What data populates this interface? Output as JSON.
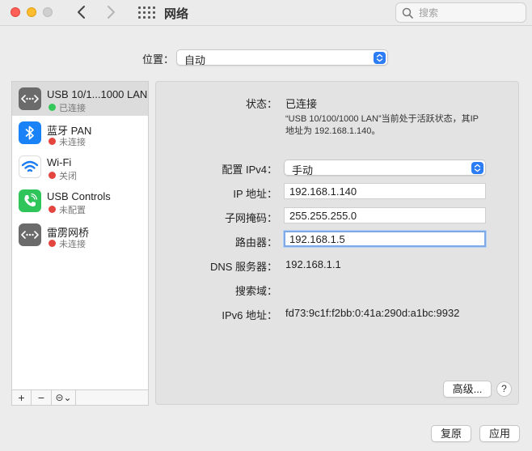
{
  "window": {
    "title": "网络",
    "search_placeholder": "搜索"
  },
  "location": {
    "label": "位置：",
    "value": "自动"
  },
  "sidebar": {
    "services": [
      {
        "name": "USB 10/1...1000 LAN",
        "status": "已连接",
        "status_color": "#34c759",
        "icon": "ethernet-icon",
        "selected": true
      },
      {
        "name": "蓝牙 PAN",
        "status": "未连接",
        "status_color": "#e5453f",
        "icon": "bluetooth-icon"
      },
      {
        "name": "Wi-Fi",
        "status": "关闭",
        "status_color": "#e5453f",
        "icon": "wifi-icon"
      },
      {
        "name": "USB Controls",
        "status": "未配置",
        "status_color": "#e5453f",
        "icon": "phone-icon"
      },
      {
        "name": "雷雳网桥",
        "status": "未连接",
        "status_color": "#e5453f",
        "icon": "ethernet-icon"
      }
    ],
    "tools": {
      "add": "+",
      "remove": "−",
      "action": "⊝⌄"
    }
  },
  "detail": {
    "status_label": "状态：",
    "status_value": "已连接",
    "status_desc": "“USB 10/100/1000 LAN”当前处于活跃状态，其IP地址为 192.168.1.140。",
    "ipv4_label": "配置 IPv4：",
    "ipv4_value": "手动",
    "ip_label": "IP 地址：",
    "ip_value": "192.168.1.140",
    "subnet_label": "子网掩码：",
    "subnet_value": "255.255.255.0",
    "router_label": "路由器：",
    "router_value": "192.168.1.5",
    "dns_label": "DNS 服务器：",
    "dns_value": "192.168.1.1",
    "search_domain_label": "搜索域：",
    "ipv6_label": "IPv6 地址：",
    "ipv6_value": "fd73:9c1f:f2bb:0:41a:290d:a1bc:9932",
    "advanced_button": "高级...",
    "help_button": "?"
  },
  "footer": {
    "revert_button": "复原",
    "apply_button": "应用"
  }
}
